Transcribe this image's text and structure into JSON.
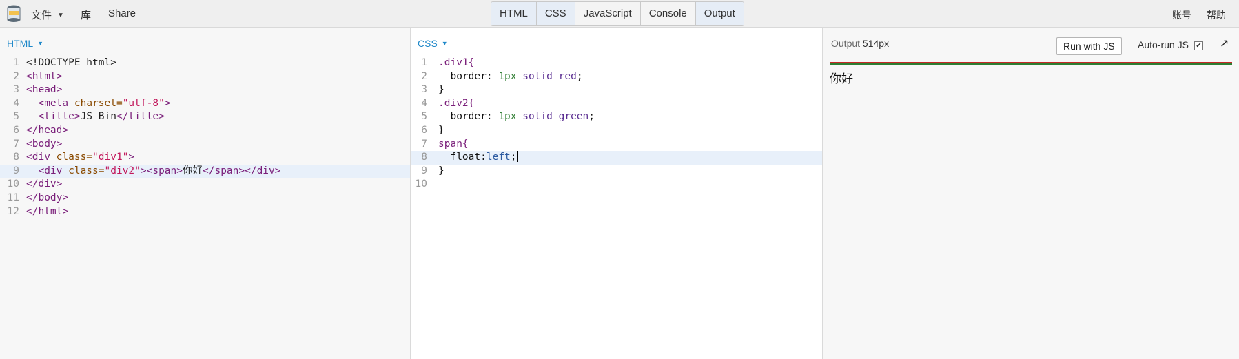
{
  "topbar": {
    "menu": {
      "file": "文件",
      "library": "库",
      "share": "Share"
    },
    "tabs": [
      "HTML",
      "CSS",
      "JavaScript",
      "Console",
      "Output"
    ],
    "right": {
      "account": "账号",
      "help": "帮助"
    }
  },
  "html_panel": {
    "label": "HTML",
    "line_numbers": [
      "1",
      "2",
      "3",
      "4",
      "5",
      "6",
      "7",
      "8",
      "9",
      "10",
      "11",
      "12"
    ],
    "lines": {
      "l1": "<!DOCTYPE html>",
      "l2": "<html>",
      "l3": "<head>",
      "l4_tag": "<meta",
      "l4_attr": " charset=",
      "l4_val": "\"utf-8\"",
      "l4_close": ">",
      "l5_open": "<title>",
      "l5_text": "JS Bin",
      "l5_close": "</title>",
      "l6": "</head>",
      "l7": "<body>",
      "l8_tag": "<div",
      "l8_attr": " class=",
      "l8_val": "\"div1\"",
      "l8_close": ">",
      "l9_tag": "<div",
      "l9_attr": " class=",
      "l9_val": "\"div2\"",
      "l9_open": "><span>",
      "l9_text": "你好",
      "l9_close": "</span></div>",
      "l10": "</div>",
      "l11": "</body>",
      "l12": "</html>"
    }
  },
  "css_panel": {
    "label": "CSS",
    "line_numbers": [
      "1",
      "2",
      "3",
      "4",
      "5",
      "6",
      "7",
      "8",
      "9",
      "10"
    ],
    "lines": {
      "l1": ".div1{",
      "l2_prop": "border: ",
      "l2_num": "1px",
      "l2_kw": " solid ",
      "l2_val": "red",
      "l2_end": ";",
      "l3": "}",
      "l4": ".div2{",
      "l5_prop": "border: ",
      "l5_num": "1px",
      "l5_kw": " solid ",
      "l5_val": "green",
      "l5_end": ";",
      "l6": "}",
      "l7": "span{",
      "l8_prop": "float:",
      "l8_val": "left",
      "l8_end": ";",
      "l9": "}"
    }
  },
  "output_panel": {
    "title": "Output",
    "width_label": "514px",
    "run_button": "Run with JS",
    "autorun_label": "Auto-run JS",
    "autorun_checked": "✔",
    "popout_icon": "↗",
    "preview_text": "你好"
  },
  "colors": {
    "accent": "#1e88c9",
    "div1_border": "#c62828",
    "div2_border": "#2e7d32"
  }
}
